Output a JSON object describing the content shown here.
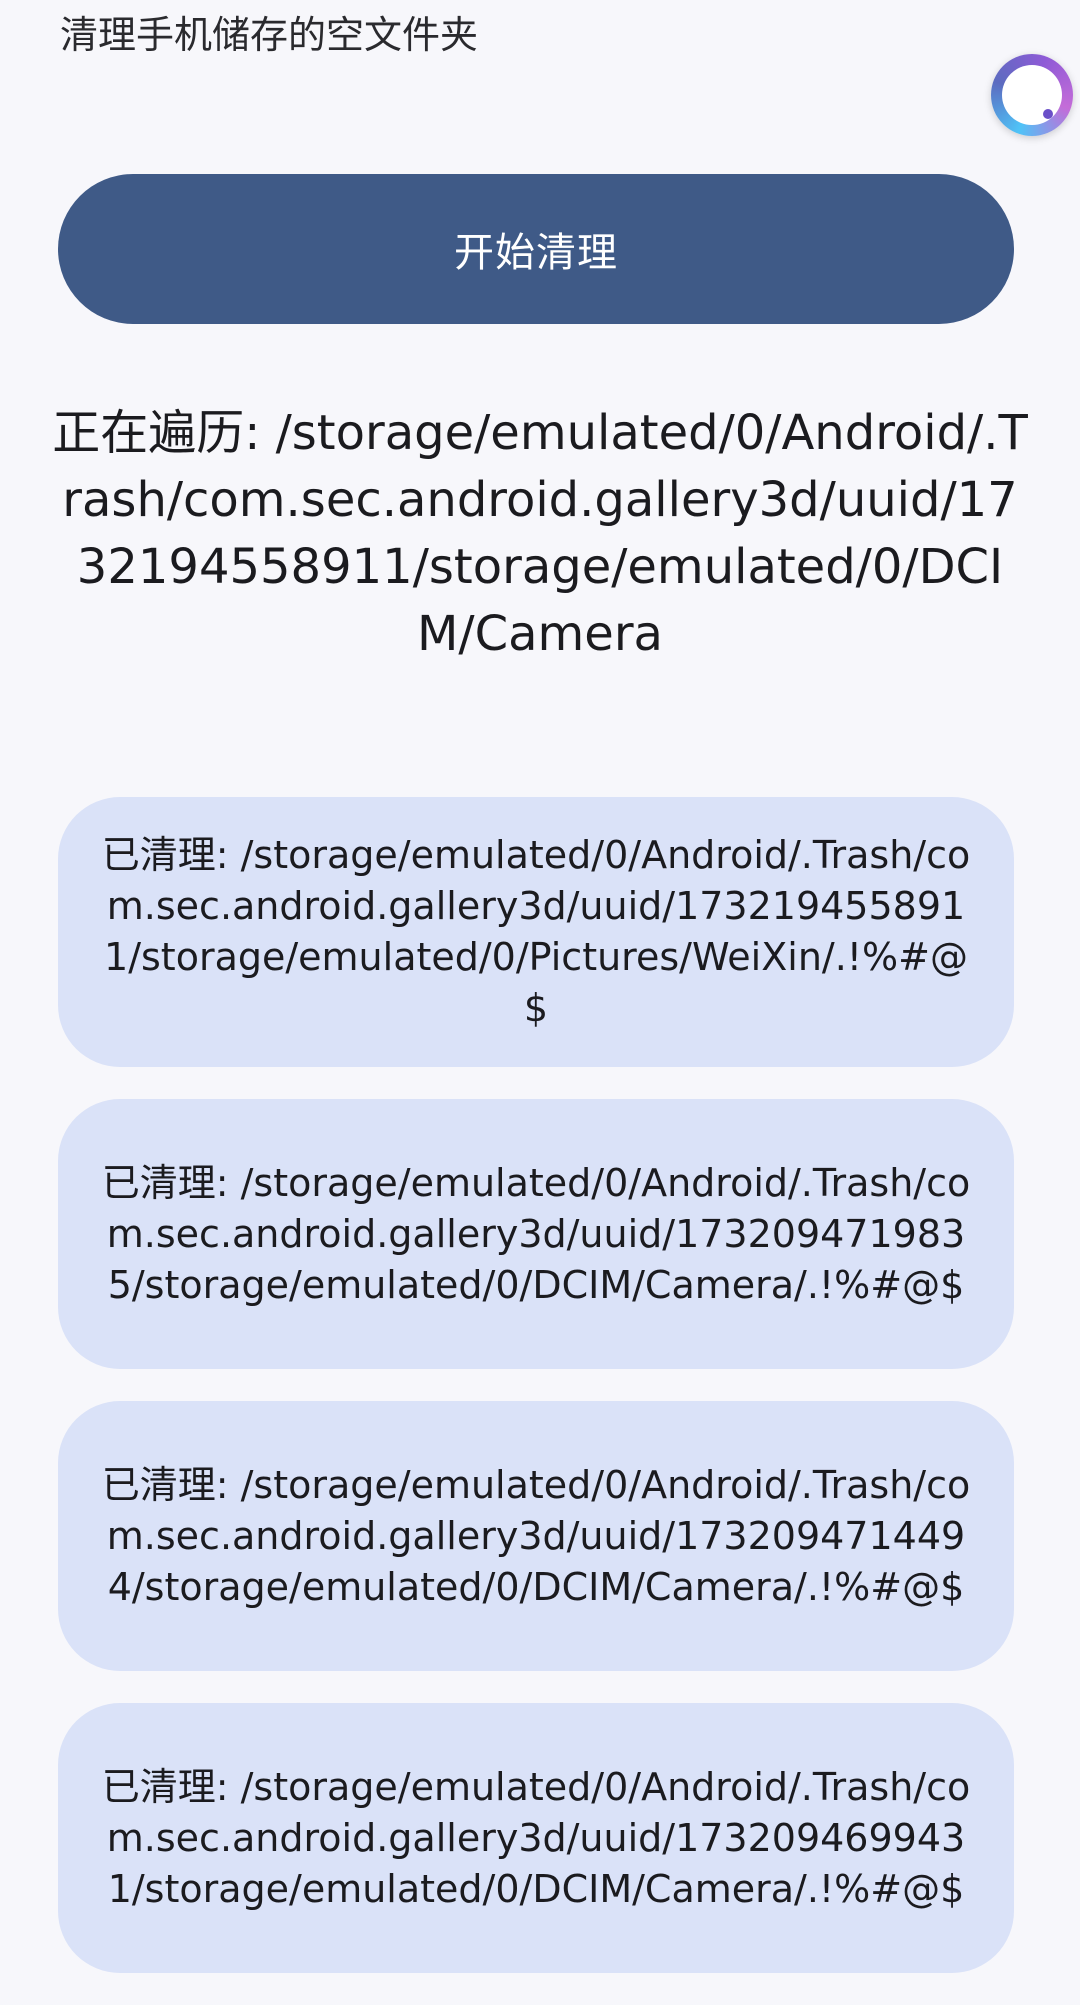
{
  "app_title": "清理手机储存的空文件夹",
  "start_button": {
    "label": "开始清理"
  },
  "scanning": {
    "text": "正在遍历: /storage/emulated/0/Android/.Trash/com.sec.android.gallery3d/uuid/1732194558911/storage/emulated/0/DCIM/Camera"
  },
  "cleaned_items": [
    {
      "text": "已清理: /storage/emulated/0/Android/.Trash/com.sec.android.gallery3d/uuid/1732194558911/storage/emulated/0/Pictures/WeiXin/.!%#@$"
    },
    {
      "text": "已清理: /storage/emulated/0/Android/.Trash/com.sec.android.gallery3d/uuid/1732094719835/storage/emulated/0/DCIM/Camera/.!%#@$"
    },
    {
      "text": "已清理: /storage/emulated/0/Android/.Trash/com.sec.android.gallery3d/uuid/1732094714494/storage/emulated/0/DCIM/Camera/.!%#@$"
    },
    {
      "text": "已清理: /storage/emulated/0/Android/.Trash/com.sec.android.gallery3d/uuid/1732094699431/storage/emulated/0/DCIM/Camera/.!%#@$"
    }
  ],
  "colors": {
    "background": "#F7F7FB",
    "primary_button": "#3F5A87",
    "card_background": "#DAE2F8"
  },
  "icons": {
    "floating_assistant": "floating-assistant-icon"
  }
}
